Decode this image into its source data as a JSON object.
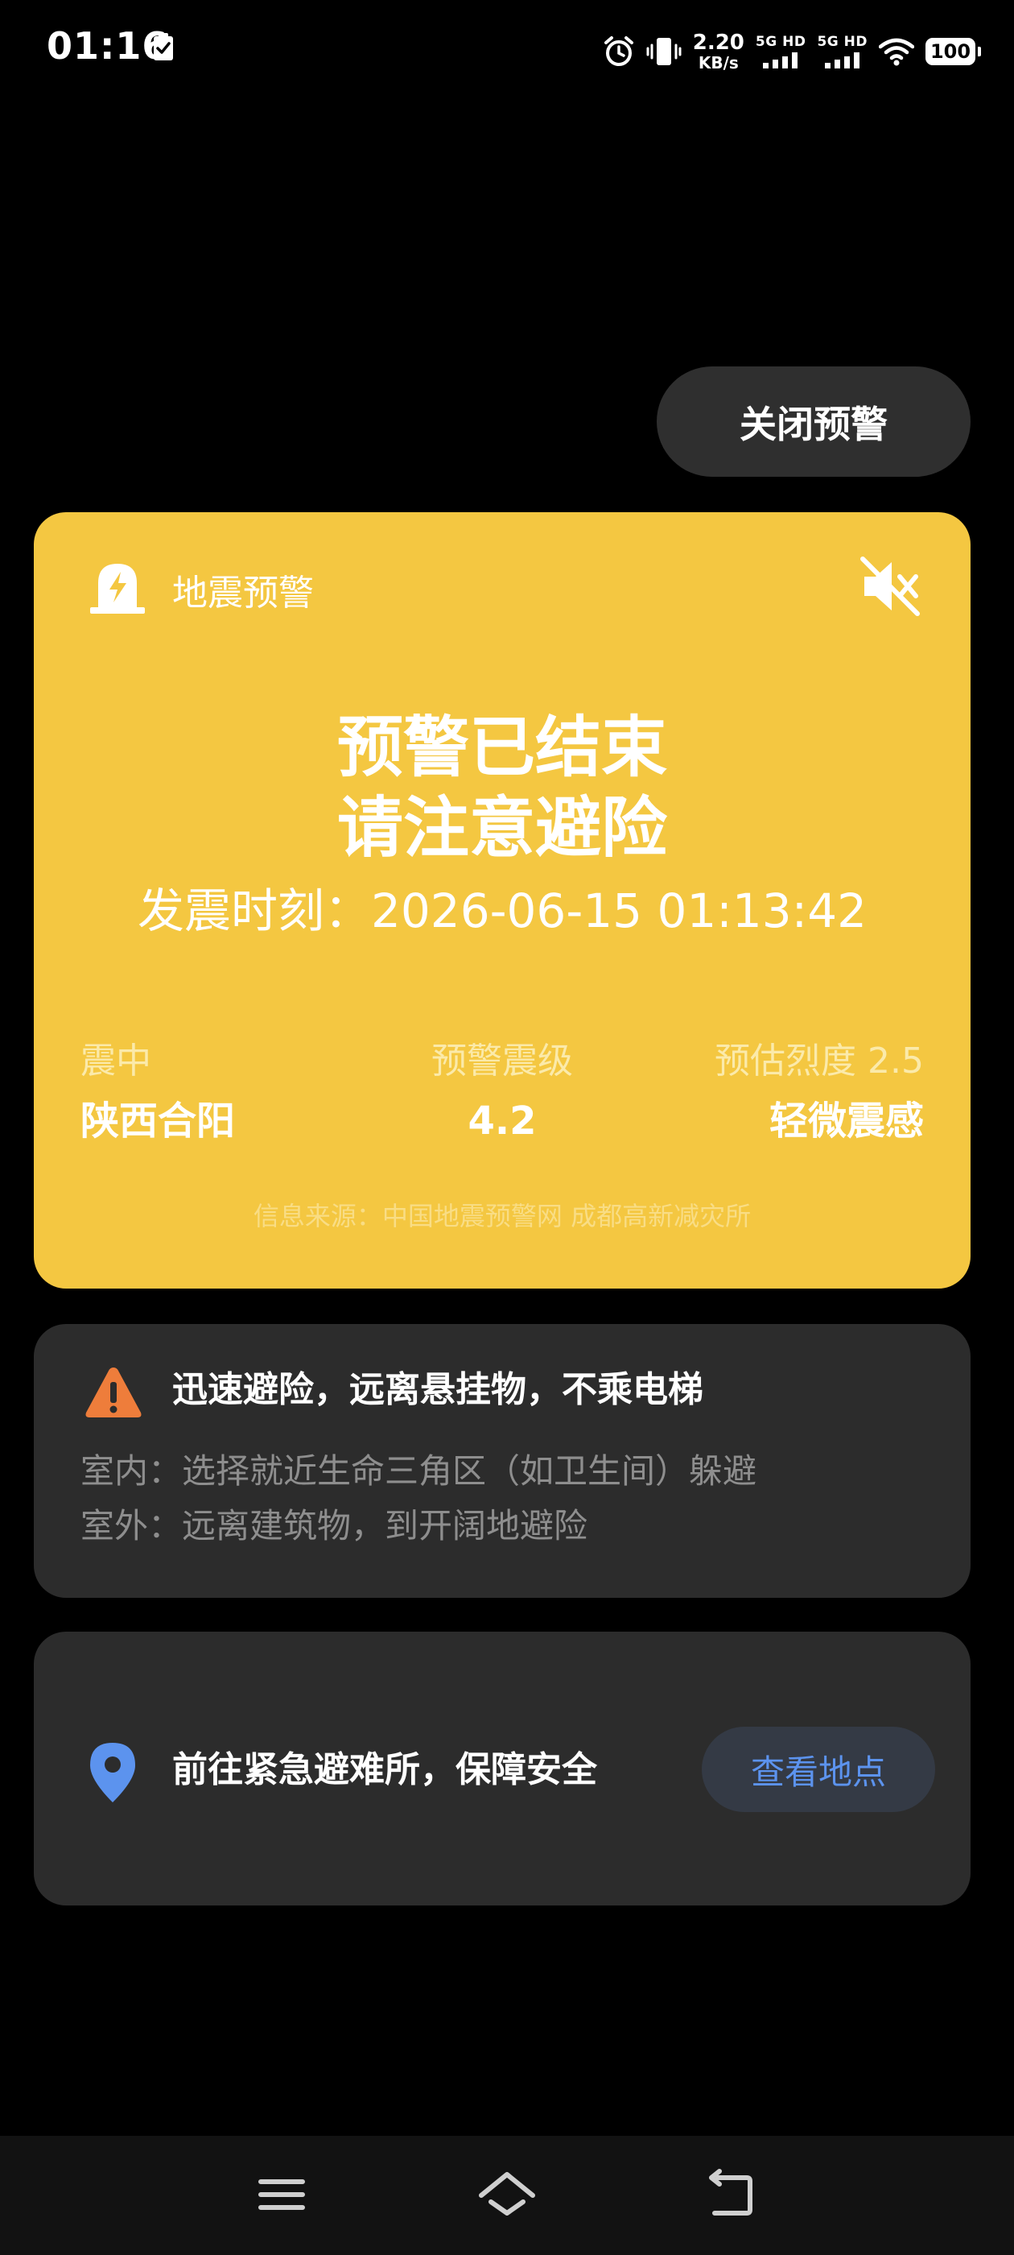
{
  "status_bar": {
    "time": "01:16",
    "speed_value": "2.20",
    "speed_unit": "KB/s",
    "sim1_label": "5G HD",
    "sim2_label": "5G HD",
    "battery": "100"
  },
  "close_button": {
    "label": "关闭预警"
  },
  "alert_card": {
    "title": "地震预警",
    "headline_line1": "预警已结束",
    "headline_line2": "请注意避险",
    "occurrence_time": "发震时刻：2026-06-15 01:13:42",
    "epicenter_label": "震中",
    "epicenter_value": "陕西合阳",
    "magnitude_label": "预警震级",
    "magnitude_value": "4.2",
    "intensity_label": "预估烈度 2.5",
    "intensity_value": "轻微震感",
    "source": "信息来源：中国地震预警网 成都高新减灾所",
    "background_color": "#f4c741"
  },
  "advice_card": {
    "title": "迅速避险，远离悬挂物，不乘电梯",
    "indoor": "室内：选择就近生命三角区（如卫生间）躲避",
    "outdoor": "室外：远离建筑物，到开阔地避险",
    "warning_icon_color": "#ee7d3b"
  },
  "shelter_card": {
    "text": "前往紧急避难所，保障安全",
    "button_label": "查看地点",
    "accent_color": "#5c93ee"
  }
}
